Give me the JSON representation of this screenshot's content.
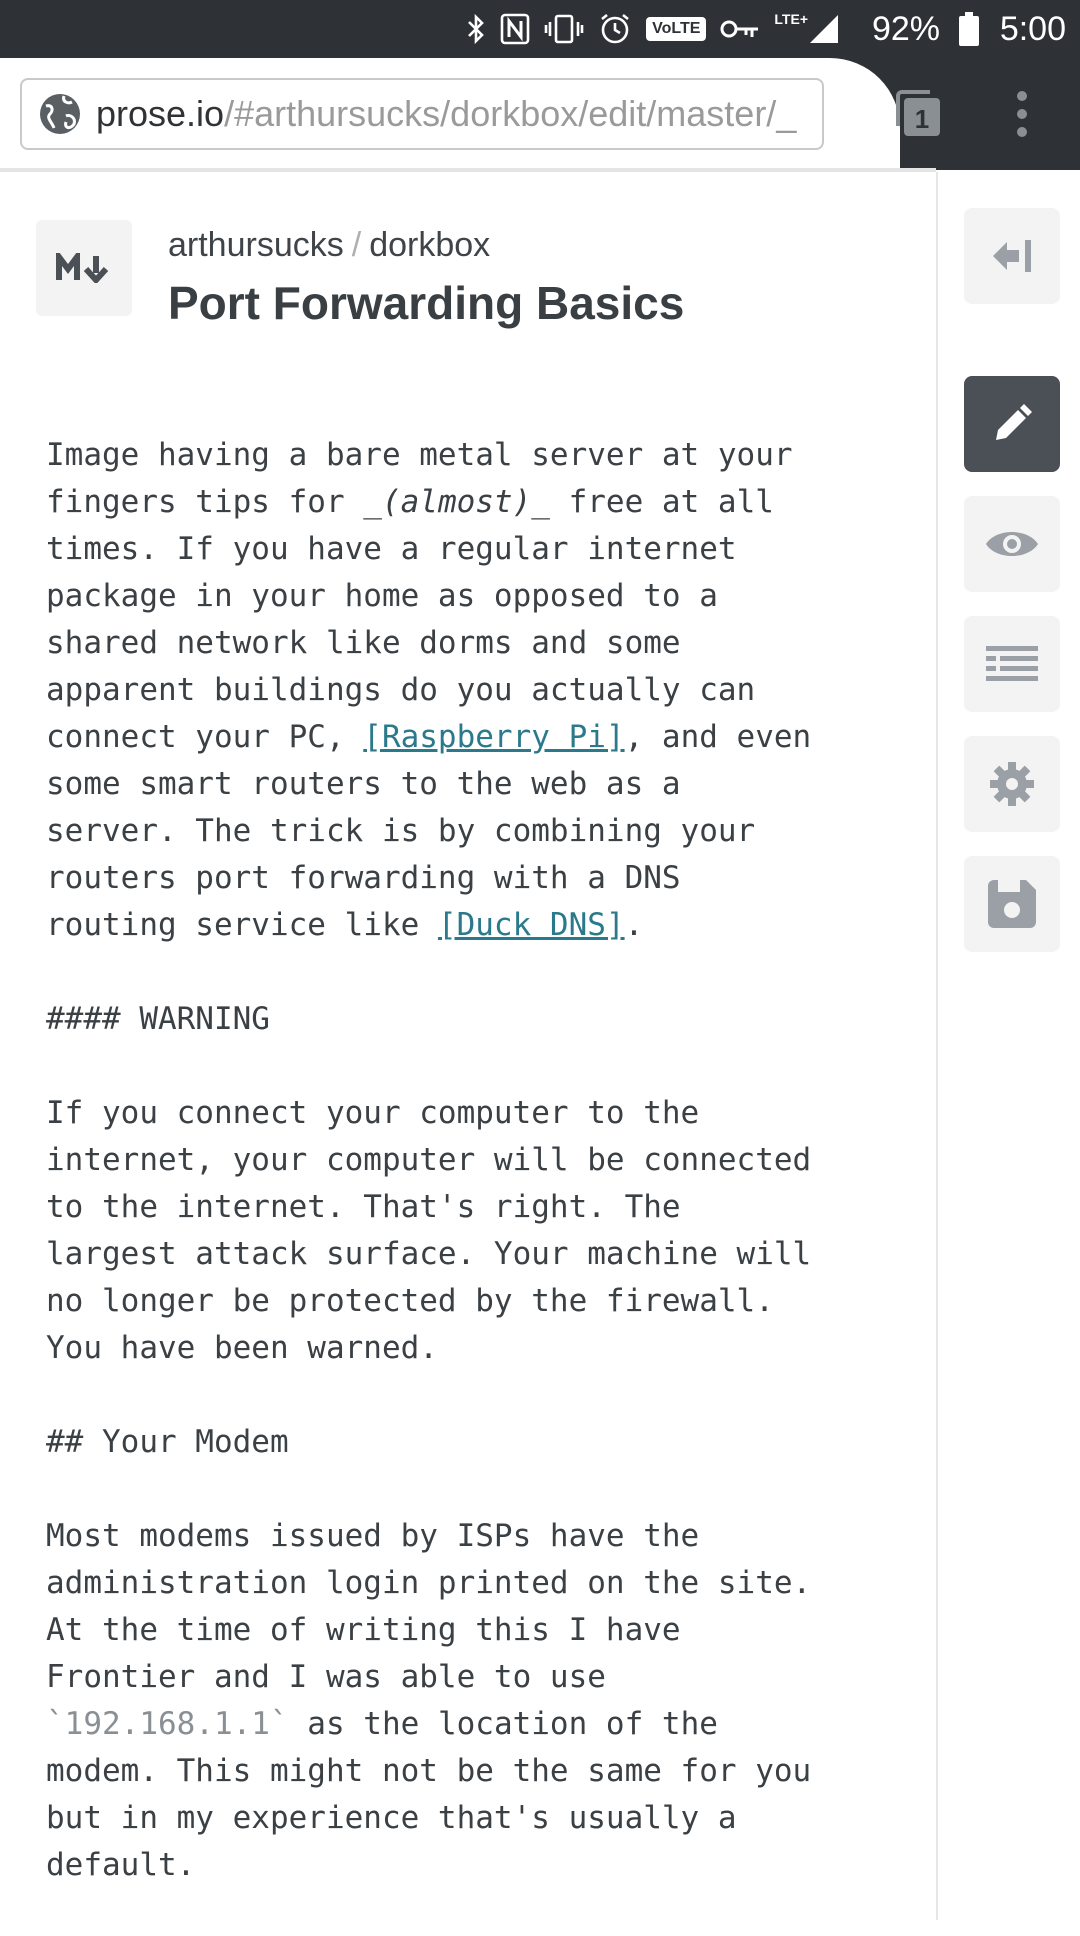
{
  "status_bar": {
    "battery_percent": "92%",
    "time": "5:00",
    "network_label": "VoLTE",
    "lte_label": "LTE+",
    "icons": [
      "bluetooth-icon",
      "nfc-icon",
      "vibrate-icon",
      "alarm-icon",
      "volte-icon",
      "vpn-key-icon",
      "signal-icon",
      "battery-icon"
    ]
  },
  "browser": {
    "url_host": "prose.io",
    "url_path": "/#arthursucks/dorkbox/edit/master/_",
    "tab_count": "1",
    "icons": [
      "globe-icon",
      "tabs-icon",
      "overflow-menu-icon"
    ]
  },
  "header": {
    "owner": "arthursucks",
    "separator": "/",
    "repo": "dorkbox",
    "title": "Port Forwarding Basics",
    "badge_icon": "markdown-icon"
  },
  "sidebar": {
    "buttons": [
      {
        "name": "back-to-repo-button",
        "icon": "arrow-left-bar-icon",
        "active": false
      },
      {
        "name": "edit-button",
        "icon": "pencil-icon",
        "active": true
      },
      {
        "name": "preview-button",
        "icon": "eye-icon",
        "active": false
      },
      {
        "name": "metadata-button",
        "icon": "list-icon",
        "active": false
      },
      {
        "name": "settings-button",
        "icon": "gear-icon",
        "active": false
      },
      {
        "name": "save-button",
        "icon": "save-icon",
        "active": false
      }
    ]
  },
  "editor": {
    "p1_a": "Image having a bare metal server at your\nfingers tips for _",
    "p1_em": "(almost)",
    "p1_b": "_ free at all\ntimes. If you have a regular internet\npackage in your home as opposed to a\nshared network like dorms and some\napparent buildings do you actually can\nconnect your PC, ",
    "p1_link1": "[Raspberry Pi]",
    "p1_c": ", and even\nsome smart routers to the web as a\nserver. The trick is by combining your\nrouters port forwarding with a DNS\nrouting service like ",
    "p1_link2": "[Duck DNS]",
    "p1_d": ".",
    "h_warning": "#### WARNING",
    "p2": "If you connect your computer to the\ninternet, your computer will be connected\nto the internet. That's right. The\nlargest attack surface. Your machine will\nno longer be protected by the firewall.\nYou have been warned.",
    "h_modem": "## Your Modem",
    "p3_a": "Most modems issued by ISPs have the\nadministration login printed on the site.\nAt the time of writing this I have\nFrontier and I was able to use\n",
    "p3_code": "`192.168.1.1`",
    "p3_b": " as the location of the\nmodem. This might not be the same for you\nbut in my experience that's usually a\ndefault."
  }
}
